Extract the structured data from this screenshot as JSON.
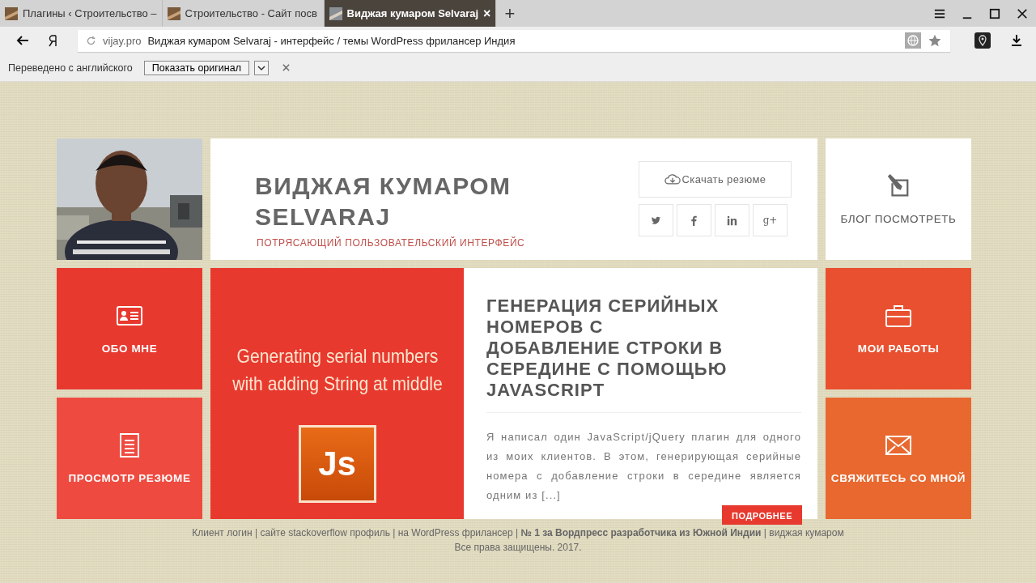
{
  "tab_close": "×",
  "new_tab": "+",
  "tabs": [
    {
      "title": "Плагины ‹ Строительство –",
      "selected": false
    },
    {
      "title": "Строительство - Сайт посв",
      "selected": false
    },
    {
      "title": "Виджая кумаром Selvaraj",
      "selected": true
    }
  ],
  "address_bar": {
    "domain": "vijay.pro",
    "page_title": "Виджая кумаром Selvaraj - интерфейс / темы WordPress фрилансер Индия"
  },
  "translate_bar": {
    "message": "Переведено с английского",
    "button": "Показать оригинал"
  },
  "header": {
    "name": "ВИДЖАЯ КУМАРОМ SELVARAJ",
    "tagline": "ПОТРЯСАЮЩИЙ ПОЛЬЗОВАТЕЛЬСКИЙ ИНТЕРФЕЙС",
    "download_button": "Скачать резюме",
    "social": [
      {
        "kind": "twitter"
      },
      {
        "kind": "facebook"
      },
      {
        "kind": "linkedin"
      },
      {
        "kind": "gplus",
        "label": "g+"
      }
    ]
  },
  "tiles": [
    {
      "kind": "blog",
      "label": "БЛОГ ПОСМОТРЕТЬ",
      "color": "#ffffff"
    },
    {
      "kind": "about",
      "label": "ОБО МНЕ",
      "color": "#e8392f"
    },
    {
      "kind": "works",
      "label": "МОИ РАБОТЫ",
      "color": "#e8502f"
    },
    {
      "kind": "resume",
      "label": "ПРОСМОТР РЕЗЮМЕ",
      "color": "#ee4a40"
    },
    {
      "kind": "contact",
      "label": "СВЯЖИТЕСЬ СО МНОЙ",
      "color": "#e8682f"
    }
  ],
  "post": {
    "banner_text": "Generating serial numbers with adding String at middle",
    "badge": "Js",
    "title": "ГЕНЕРАЦИЯ СЕРИЙНЫХ НОМЕРОВ С ДОБАВЛЕНИЕ СТРОКИ В СЕРЕДИНЕ С ПОМОЩЬЮ JAVASCRIPT",
    "excerpt": "Я написал один JavaScript/jQuery плагин для одного из моих клиентов. В этом, генерирующая серийные номера с добавление строки в середине является одним из [...]",
    "more_button": "ПОДРОБНЕЕ"
  },
  "footer": {
    "text": "Клиент логин | сайте stackoverflow профиль | на WordPress фрилансер | **№ 1 за Вордпресс разработчика из Южной Индии** | виджая кумаром",
    "copyright": "Все права защищены. 2017."
  }
}
